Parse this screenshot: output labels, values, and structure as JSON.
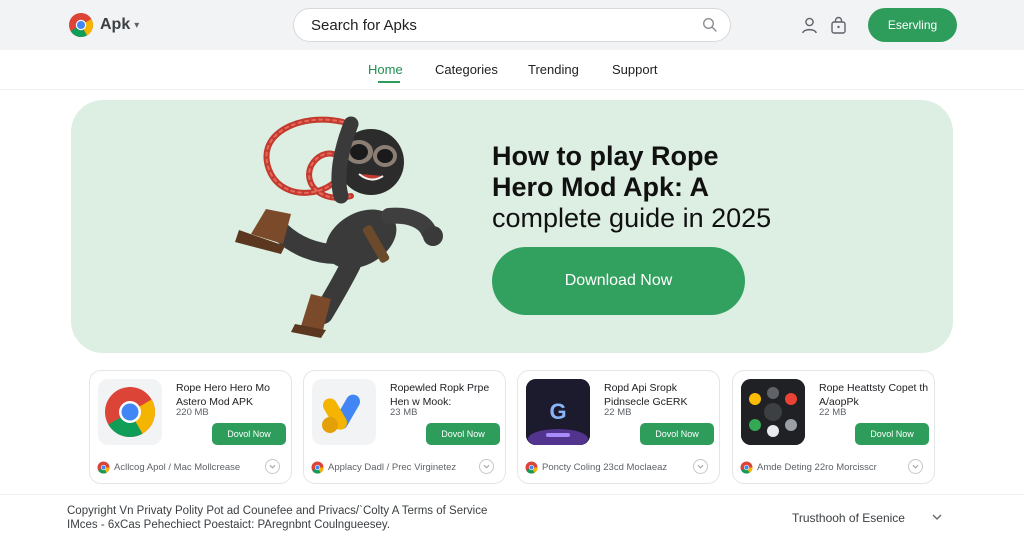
{
  "header": {
    "logo_text": "Apk",
    "search_placeholder": "Search for Apks",
    "action_button": "Eservling",
    "icons": [
      "chrome-logo-icon",
      "search-icon",
      "user-icon",
      "bag-icon"
    ]
  },
  "nav": {
    "items": [
      "Home",
      "Categories",
      "Trending",
      "Support"
    ],
    "active": "Home"
  },
  "hero": {
    "title_line1": "How to play Rope",
    "title_line2": "Hero Mod Apk: A",
    "title_line3": "complete guide in 2025",
    "button": "Download Now"
  },
  "cards": [
    {
      "title": "Rope Hero Hero Mo Astero Mod APK",
      "size": "220 MB",
      "button": "Dovol Now",
      "footer": "Acllcog Apol / Mac Mollcrease",
      "icon": "chrome-icon"
    },
    {
      "title": "Ropewled Ropk Prpe Hen w Mook:",
      "size": "23 MB",
      "button": "Dovol Now",
      "footer": "Applacy Dadl / Prec Virginetez",
      "icon": "google-ads-icon"
    },
    {
      "title": "Ropd Api Sropk Pidnsecle GcERK",
      "size": "22 MB",
      "button": "Dovol Now",
      "footer": "Poncty Coling 23cd Moclaeaz",
      "icon": "google-g-icon"
    },
    {
      "title": "Rope Heattsty Copet th A/aopPk",
      "size": "22 MB",
      "button": "Dovol Now",
      "footer": "Amde Deting 22ro Morcisscr",
      "icon": "app-cluster-icon"
    }
  ],
  "footer": {
    "line1": "Copyright Vn Privaty Polity Pot ad Counefee and Privacs/`Colty A Terms of Service",
    "line2": "IMces - 6xCas Pehechiect Poestaict: PAregnbnt Coulngueesey.",
    "right": "Trusthooh of Esenice"
  },
  "colors": {
    "accent": "#2e9d5c",
    "hero_bg": "#dcefe2",
    "header_bg": "#f1f3f4"
  }
}
